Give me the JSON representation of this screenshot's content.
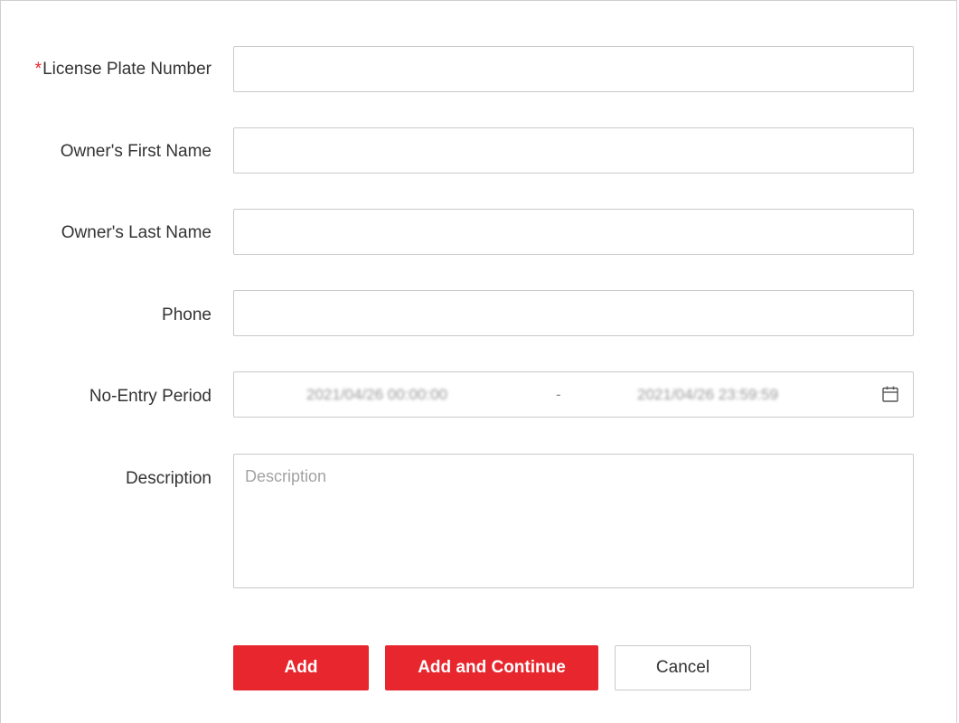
{
  "form": {
    "fields": {
      "license_plate": {
        "required_mark": "*",
        "label": "License Plate Number",
        "value": ""
      },
      "first_name": {
        "label": "Owner's First Name",
        "value": ""
      },
      "last_name": {
        "label": "Owner's Last Name",
        "value": ""
      },
      "phone": {
        "label": "Phone",
        "value": ""
      },
      "no_entry_period": {
        "label": "No-Entry Period",
        "start": "2021/04/26 00:00:00",
        "separator": "-",
        "end": "2021/04/26 23:59:59",
        "icon": "calendar-icon"
      },
      "description": {
        "label": "Description",
        "placeholder": "Description",
        "value": ""
      }
    },
    "buttons": {
      "add": "Add",
      "add_continue": "Add and Continue",
      "cancel": "Cancel"
    }
  },
  "colors": {
    "accent": "#e8262e",
    "border": "#c9c9c9",
    "text": "#333333"
  }
}
